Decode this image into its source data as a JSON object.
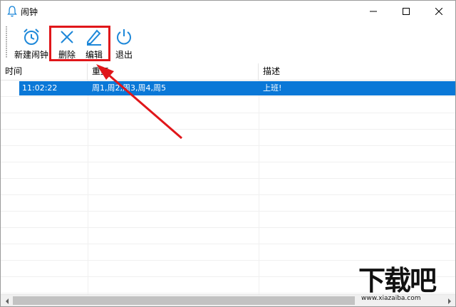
{
  "window": {
    "title": "闹钟"
  },
  "toolbar": {
    "new_label": "新建闹钟",
    "delete_label": "删除",
    "edit_label": "编辑",
    "exit_label": "退出"
  },
  "list": {
    "columns": [
      "时间",
      "重复",
      "描述"
    ],
    "rows": [
      {
        "time": "11:02:22",
        "repeat": "周1,周2,周3,周4,周5",
        "desc": "上班!"
      }
    ]
  },
  "watermark": {
    "logo": "下载吧",
    "url": "www.xiazaiba.com"
  },
  "colors": {
    "accent": "#0a78d7",
    "highlight": "#e0161a",
    "icon": "#1e88d9"
  }
}
